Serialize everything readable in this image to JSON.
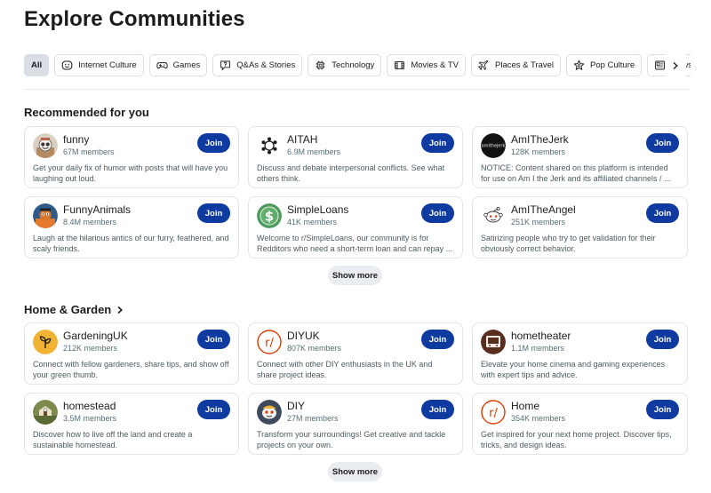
{
  "page_title": "Explore Communities",
  "filters": [
    {
      "label": "All",
      "icon": "none",
      "active": true
    },
    {
      "label": "Internet Culture",
      "icon": "smile-icon"
    },
    {
      "label": "Games",
      "icon": "gamepad-icon"
    },
    {
      "label": "Q&As & Stories",
      "icon": "question-bubble-icon"
    },
    {
      "label": "Technology",
      "icon": "chip-icon"
    },
    {
      "label": "Movies & TV",
      "icon": "film-icon"
    },
    {
      "label": "Places & Travel",
      "icon": "plane-icon"
    },
    {
      "label": "Pop Culture",
      "icon": "star-icon"
    },
    {
      "label": "News & P",
      "icon": "newspaper-icon"
    }
  ],
  "sections": {
    "recommended": {
      "title": "Recommended for you",
      "show_more": "Show more",
      "cards": [
        {
          "name": "funny",
          "members": "67M members",
          "join": "Join",
          "desc": "Get your daily fix of humor with posts that will have you laughing out loud."
        },
        {
          "name": "AITAH",
          "members": "6.9M members",
          "join": "Join",
          "desc": "Discuss and debate interpersonal conflicts. See what others think."
        },
        {
          "name": "AmITheJerk",
          "members": "128K members",
          "join": "Join",
          "desc": "NOTICE: Content shared on this platform is intended for use on Am I the Jerk and its affiliated channels / ..."
        },
        {
          "name": "FunnyAnimals",
          "members": "8.4M members",
          "join": "Join",
          "desc": "Laugh at the hilarious antics of our furry, feathered, and scaly friends."
        },
        {
          "name": "SimpleLoans",
          "members": "41K members",
          "join": "Join",
          "desc": "Welcome to r/SimpleLoans, our community is for Redditors who need a short-term loan and can repay ..."
        },
        {
          "name": "AmITheAngel",
          "members": "251K members",
          "join": "Join",
          "desc": "Satirizing people who try to get validation for their obviously correct behavior."
        }
      ]
    },
    "home_garden": {
      "title": "Home & Garden",
      "show_more": "Show more",
      "cards": [
        {
          "name": "GardeningUK",
          "members": "212K members",
          "join": "Join",
          "desc": "Connect with fellow gardeners, share tips, and show off your green thumb."
        },
        {
          "name": "DIYUK",
          "members": "807K members",
          "join": "Join",
          "desc": "Connect with other DIY enthusiasts in the UK and share project ideas."
        },
        {
          "name": "hometheater",
          "members": "1.1M members",
          "join": "Join",
          "desc": "Elevate your home cinema and gaming experiences with expert tips and advice."
        },
        {
          "name": "homestead",
          "members": "3.5M members",
          "join": "Join",
          "desc": "Discover how to live off the land and create a sustainable homestead."
        },
        {
          "name": "DIY",
          "members": "27M members",
          "join": "Join",
          "desc": "Transform your surroundings! Get creative and tackle projects on your own."
        },
        {
          "name": "Home",
          "members": "354K members",
          "join": "Join",
          "desc": "Get inspired for your next home project. Discover tips, tricks, and design ideas."
        }
      ]
    }
  },
  "colors": {
    "join_button": "#0f3ba0",
    "active_chip": "#d8dee4",
    "reddit_orange": "#d93a00"
  }
}
